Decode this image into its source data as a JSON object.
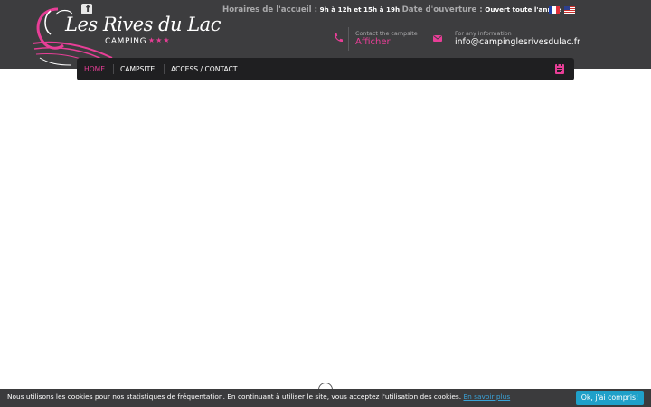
{
  "colors": {
    "header_bg": "#3d3d3f",
    "nav_bg": "#1f1f21",
    "accent_pink": "#e83e97",
    "cookie_bg": "#3b3b3d",
    "cookie_button": "#1fa0c9",
    "link_blue": "#3aa3d8"
  },
  "topbar": {
    "facebook_icon": "facebook-icon",
    "reception_label": "Horaires de l'accueil :",
    "reception_hours": "9h à 12h et 15h à 19h",
    "opening_label": "Date d'ouverture :",
    "opening_value": "Ouvert toute l'année",
    "languages": [
      "fr",
      "en-us"
    ]
  },
  "logo": {
    "title": "Les Rives du Lac",
    "subtitle": "CAMPING",
    "stars": "★★★"
  },
  "contact": {
    "phone": {
      "icon": "phone-icon",
      "label": "Contact the campsite",
      "value": "Afficher"
    },
    "email": {
      "icon": "mail-icon",
      "label": "For any information",
      "value": "info@campinglesrivesdulac.fr"
    }
  },
  "nav": {
    "home": "HOME",
    "campsite": "CAMPSITE",
    "access": "ACCESS / CONTACT",
    "book_icon": "booking-icon"
  },
  "cookie": {
    "text": "Nous utilisons les cookies pour nos statistiques de fréquentation. En continuant à utiliser le site, vous acceptez l'utilisation des cookies.",
    "link": "En savoir plus",
    "button": "Ok, j'ai compris!"
  }
}
